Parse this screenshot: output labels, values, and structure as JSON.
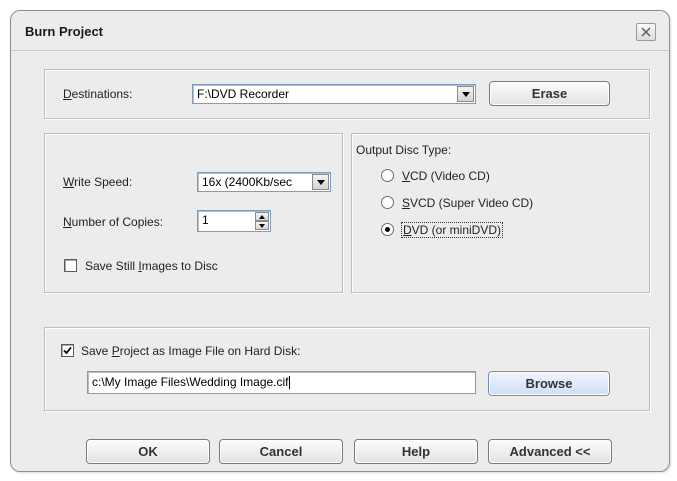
{
  "dialog": {
    "title": "Burn Project",
    "close_icon": "close-icon"
  },
  "destinations": {
    "label_underlined": "D",
    "label_rest": "estinations:",
    "value": "F:\\DVD Recorder",
    "erase_label": "Erase"
  },
  "write_speed": {
    "label_underlined": "W",
    "label_rest": "rite Speed:",
    "value": "16x (2400Kb/sec"
  },
  "copies": {
    "label_underlined": "N",
    "label_rest": "umber of Copies:",
    "value": "1"
  },
  "save_still": {
    "label_pre": "Save Still ",
    "label_underlined": "I",
    "label_post": "mages to Disc",
    "checked": false
  },
  "output_disc": {
    "group_label": "Output Disc Type:",
    "options": [
      {
        "underlined": "V",
        "rest": "CD (Video CD)",
        "selected": false
      },
      {
        "underlined": "S",
        "rest": "VCD (Super Video CD)",
        "selected": false
      },
      {
        "underlined": "D",
        "rest": "VD (or miniDVD)",
        "selected": true
      }
    ]
  },
  "save_project": {
    "label_pre": "Save ",
    "label_underlined": "P",
    "label_post": "roject as Image File on Hard Disk:",
    "checked": true,
    "path": "c:\\My Image Files\\Wedding Image.cif",
    "browse_label": "Browse"
  },
  "footer": {
    "ok_label": "OK",
    "cancel_label": "Cancel",
    "help_label": "Help",
    "advanced_label": "Advanced <<"
  }
}
